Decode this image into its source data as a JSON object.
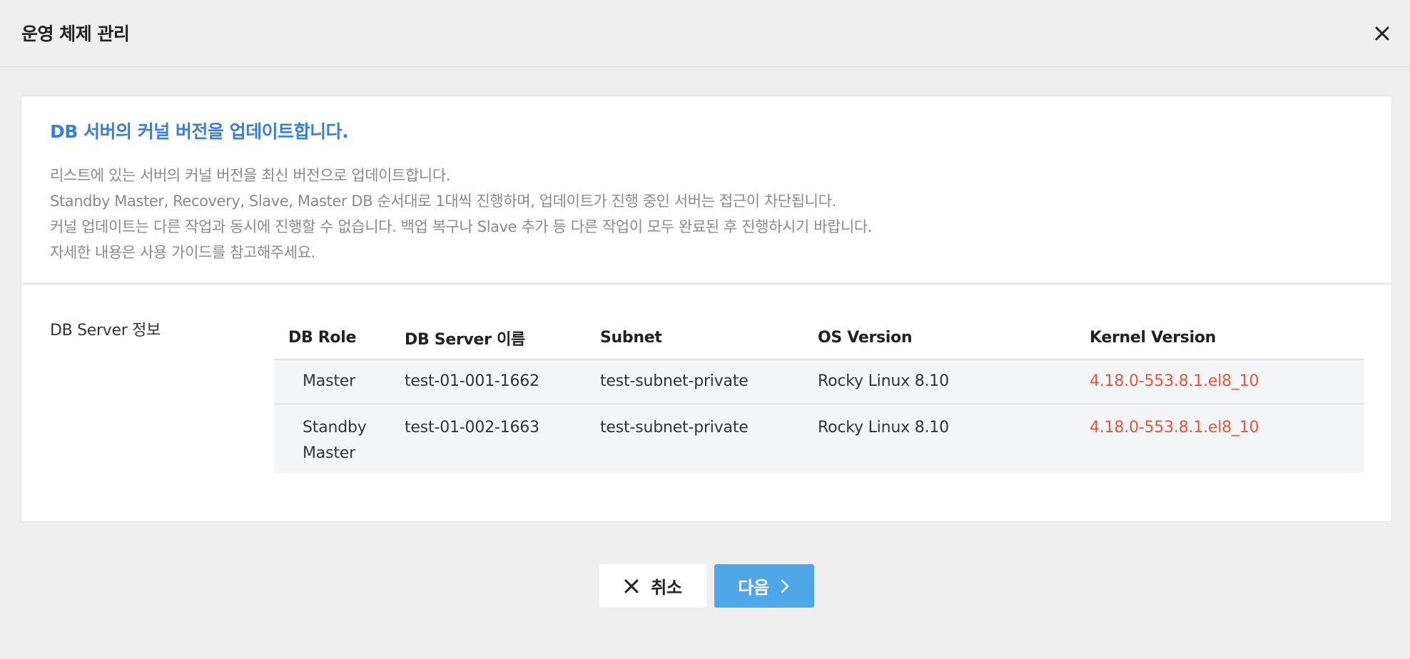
{
  "header": {
    "title": "운영 체제 관리"
  },
  "info": {
    "heading": "DB 서버의 커널 버전을 업데이트합니다.",
    "lines": [
      "리스트에 있는 서버의 커널 버전을 최신 버전으로 업데이트합니다.",
      "Standby Master, Recovery, Slave, Master DB 순서대로 1대씩 진행하며, 업데이트가 진행 중인 서버는 접근이 차단됩니다.",
      "커널 업데이트는 다른 작업과 동시에 진행할 수 없습니다. 백업 복구나 Slave 추가 등 다른 작업이 모두 완료된 후 진행하시기 바랍니다.",
      "자세한 내용은 사용 가이드를 참고해주세요."
    ]
  },
  "server": {
    "label": "DB Server 정보",
    "columns": [
      "DB Role",
      "DB Server 이름",
      "Subnet",
      "OS Version",
      "Kernel Version"
    ],
    "rows": [
      {
        "role_line1": "Master",
        "role_line2": "",
        "name": "test-01-001-1662",
        "subnet": "test-subnet-private",
        "os": "Rocky Linux 8.10",
        "kernel": "4.18.0-553.8.1.el8_10"
      },
      {
        "role_line1": "Standby",
        "role_line2": "Master",
        "name": "test-01-002-1663",
        "subnet": "test-subnet-private",
        "os": "Rocky Linux 8.10",
        "kernel": "4.18.0-553.8.1.el8_10"
      }
    ]
  },
  "buttons": {
    "cancel_label": "취소",
    "next_label": "다음"
  },
  "colors": {
    "accent_blue": "#3a7fd5",
    "kernel_red": "#e4573f",
    "next_button": "#4ea7e6"
  },
  "icons": {
    "close": "close-icon",
    "cancel": "x-icon",
    "next": "chevron-right-icon"
  }
}
